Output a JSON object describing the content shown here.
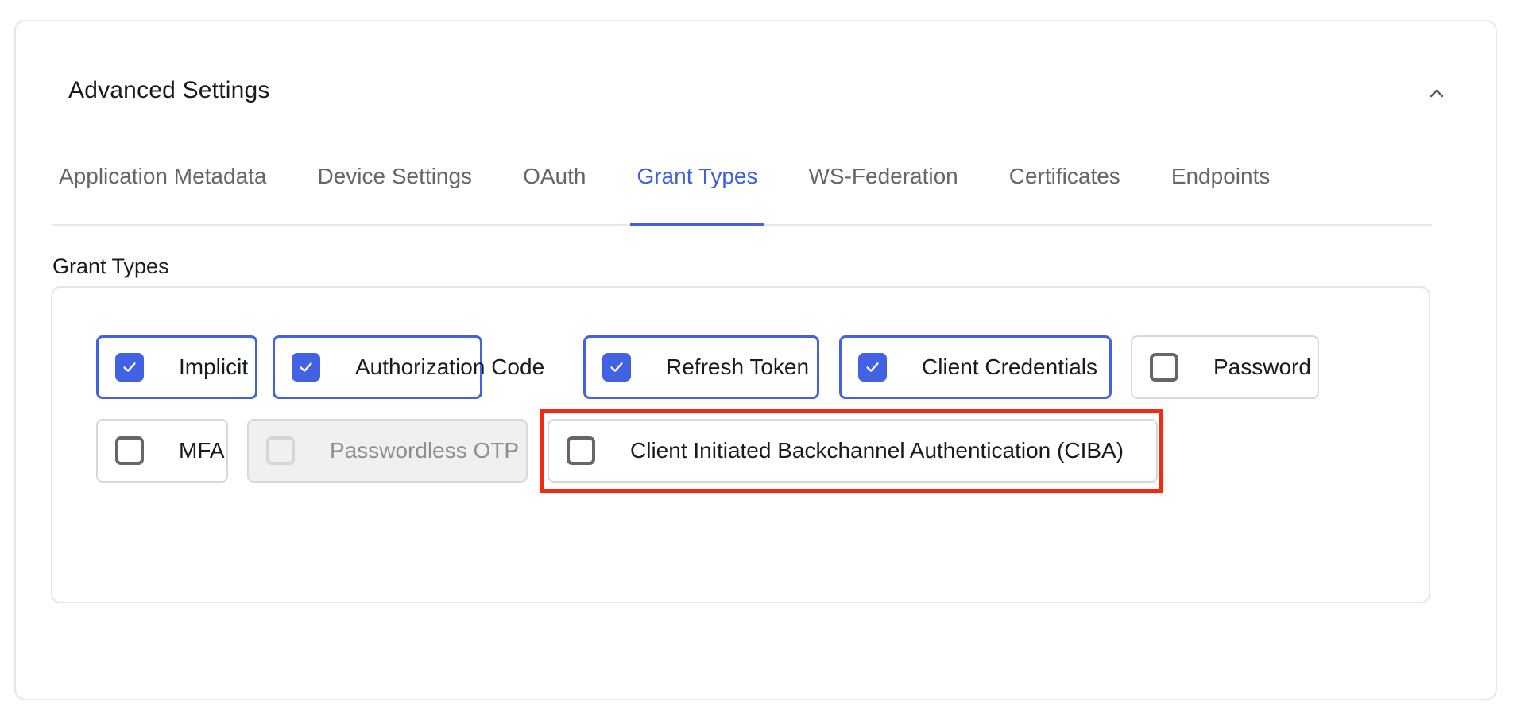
{
  "card": {
    "title": "Advanced Settings",
    "collapse_icon": "chevron-up-icon"
  },
  "tabs": [
    {
      "label": "Application Metadata",
      "active": false
    },
    {
      "label": "Device Settings",
      "active": false
    },
    {
      "label": "OAuth",
      "active": false
    },
    {
      "label": "Grant Types",
      "active": true
    },
    {
      "label": "WS-Federation",
      "active": false
    },
    {
      "label": "Certificates",
      "active": false
    },
    {
      "label": "Endpoints",
      "active": false
    }
  ],
  "grant_types": {
    "heading": "Grant Types",
    "options": [
      {
        "label": "Implicit",
        "checked": true,
        "disabled": false
      },
      {
        "label": "Authorization Code",
        "checked": true,
        "disabled": false
      },
      {
        "label": "Refresh Token",
        "checked": true,
        "disabled": false
      },
      {
        "label": "Client Credentials",
        "checked": true,
        "disabled": false
      },
      {
        "label": "Password",
        "checked": false,
        "disabled": false
      },
      {
        "label": "MFA",
        "checked": false,
        "disabled": false
      },
      {
        "label": "Passwordless OTP",
        "checked": false,
        "disabled": true
      },
      {
        "label": "Client Initiated Backchannel Authentication (CIBA)",
        "checked": false,
        "disabled": false,
        "highlighted": true
      }
    ]
  },
  "colors": {
    "accent": "#4361e3",
    "highlight": "#f32a0f",
    "border": "#e6e6e6",
    "disabled_bg": "#f0f0f0"
  }
}
